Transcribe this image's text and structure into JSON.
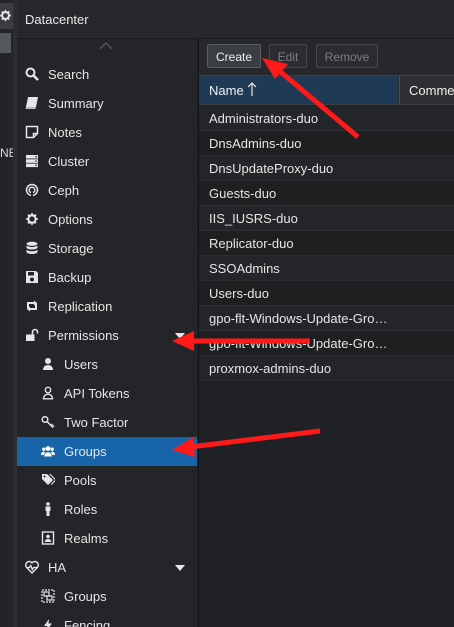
{
  "header": {
    "title": "Datacenter"
  },
  "left_strip": {
    "cut_label": "NE",
    "icon": "gear-icon"
  },
  "nav": {
    "scroll_icon": "chevron-up-icon",
    "items": [
      {
        "label": "Search",
        "icon": "search-icon"
      },
      {
        "label": "Summary",
        "icon": "book-icon"
      },
      {
        "label": "Notes",
        "icon": "note-icon"
      },
      {
        "label": "Cluster",
        "icon": "server-icon"
      },
      {
        "label": "Ceph",
        "icon": "ceph-icon"
      },
      {
        "label": "Options",
        "icon": "gear-icon"
      },
      {
        "label": "Storage",
        "icon": "database-icon"
      },
      {
        "label": "Backup",
        "icon": "floppy-icon"
      },
      {
        "label": "Replication",
        "icon": "retweet-icon"
      },
      {
        "label": "Permissions",
        "icon": "unlock-icon",
        "expanded": true
      },
      {
        "label": "Users",
        "icon": "user-icon",
        "child": true
      },
      {
        "label": "API Tokens",
        "icon": "user-outline-icon",
        "child": true
      },
      {
        "label": "Two Factor",
        "icon": "key-icon",
        "child": true
      },
      {
        "label": "Groups",
        "icon": "users-icon",
        "child": true,
        "selected": true
      },
      {
        "label": "Pools",
        "icon": "tags-icon",
        "child": true
      },
      {
        "label": "Roles",
        "icon": "male-icon",
        "child": true
      },
      {
        "label": "Realms",
        "icon": "address-book-icon",
        "child": true
      },
      {
        "label": "HA",
        "icon": "heartbeat-icon",
        "expanded": true
      },
      {
        "label": "Groups",
        "icon": "object-group-icon",
        "child": true
      },
      {
        "label": "Fencing",
        "icon": "bolt-icon",
        "child": true
      }
    ]
  },
  "toolbar": {
    "create_label": "Create",
    "edit_label": "Edit",
    "remove_label": "Remove"
  },
  "grid": {
    "columns": {
      "name": "Name",
      "comment": "Comment"
    },
    "sort_icon": "arrow-up-icon",
    "rows": [
      "Administrators-duo",
      "DnsAdmins-duo",
      "DnsUpdateProxy-duo",
      "Guests-duo",
      "IIS_IUSRS-duo",
      "Replicator-duo",
      "SSOAdmins",
      "Users-duo",
      "gpo-flt-Windows-Update-Group-A",
      "gpo-flt-Windows-Update-Group-B",
      "proxmox-admins-duo"
    ]
  },
  "colors": {
    "selected": "#1864a8",
    "annotation_arrow": "#ff1a1a",
    "header_sorted": "#1f3a55"
  }
}
